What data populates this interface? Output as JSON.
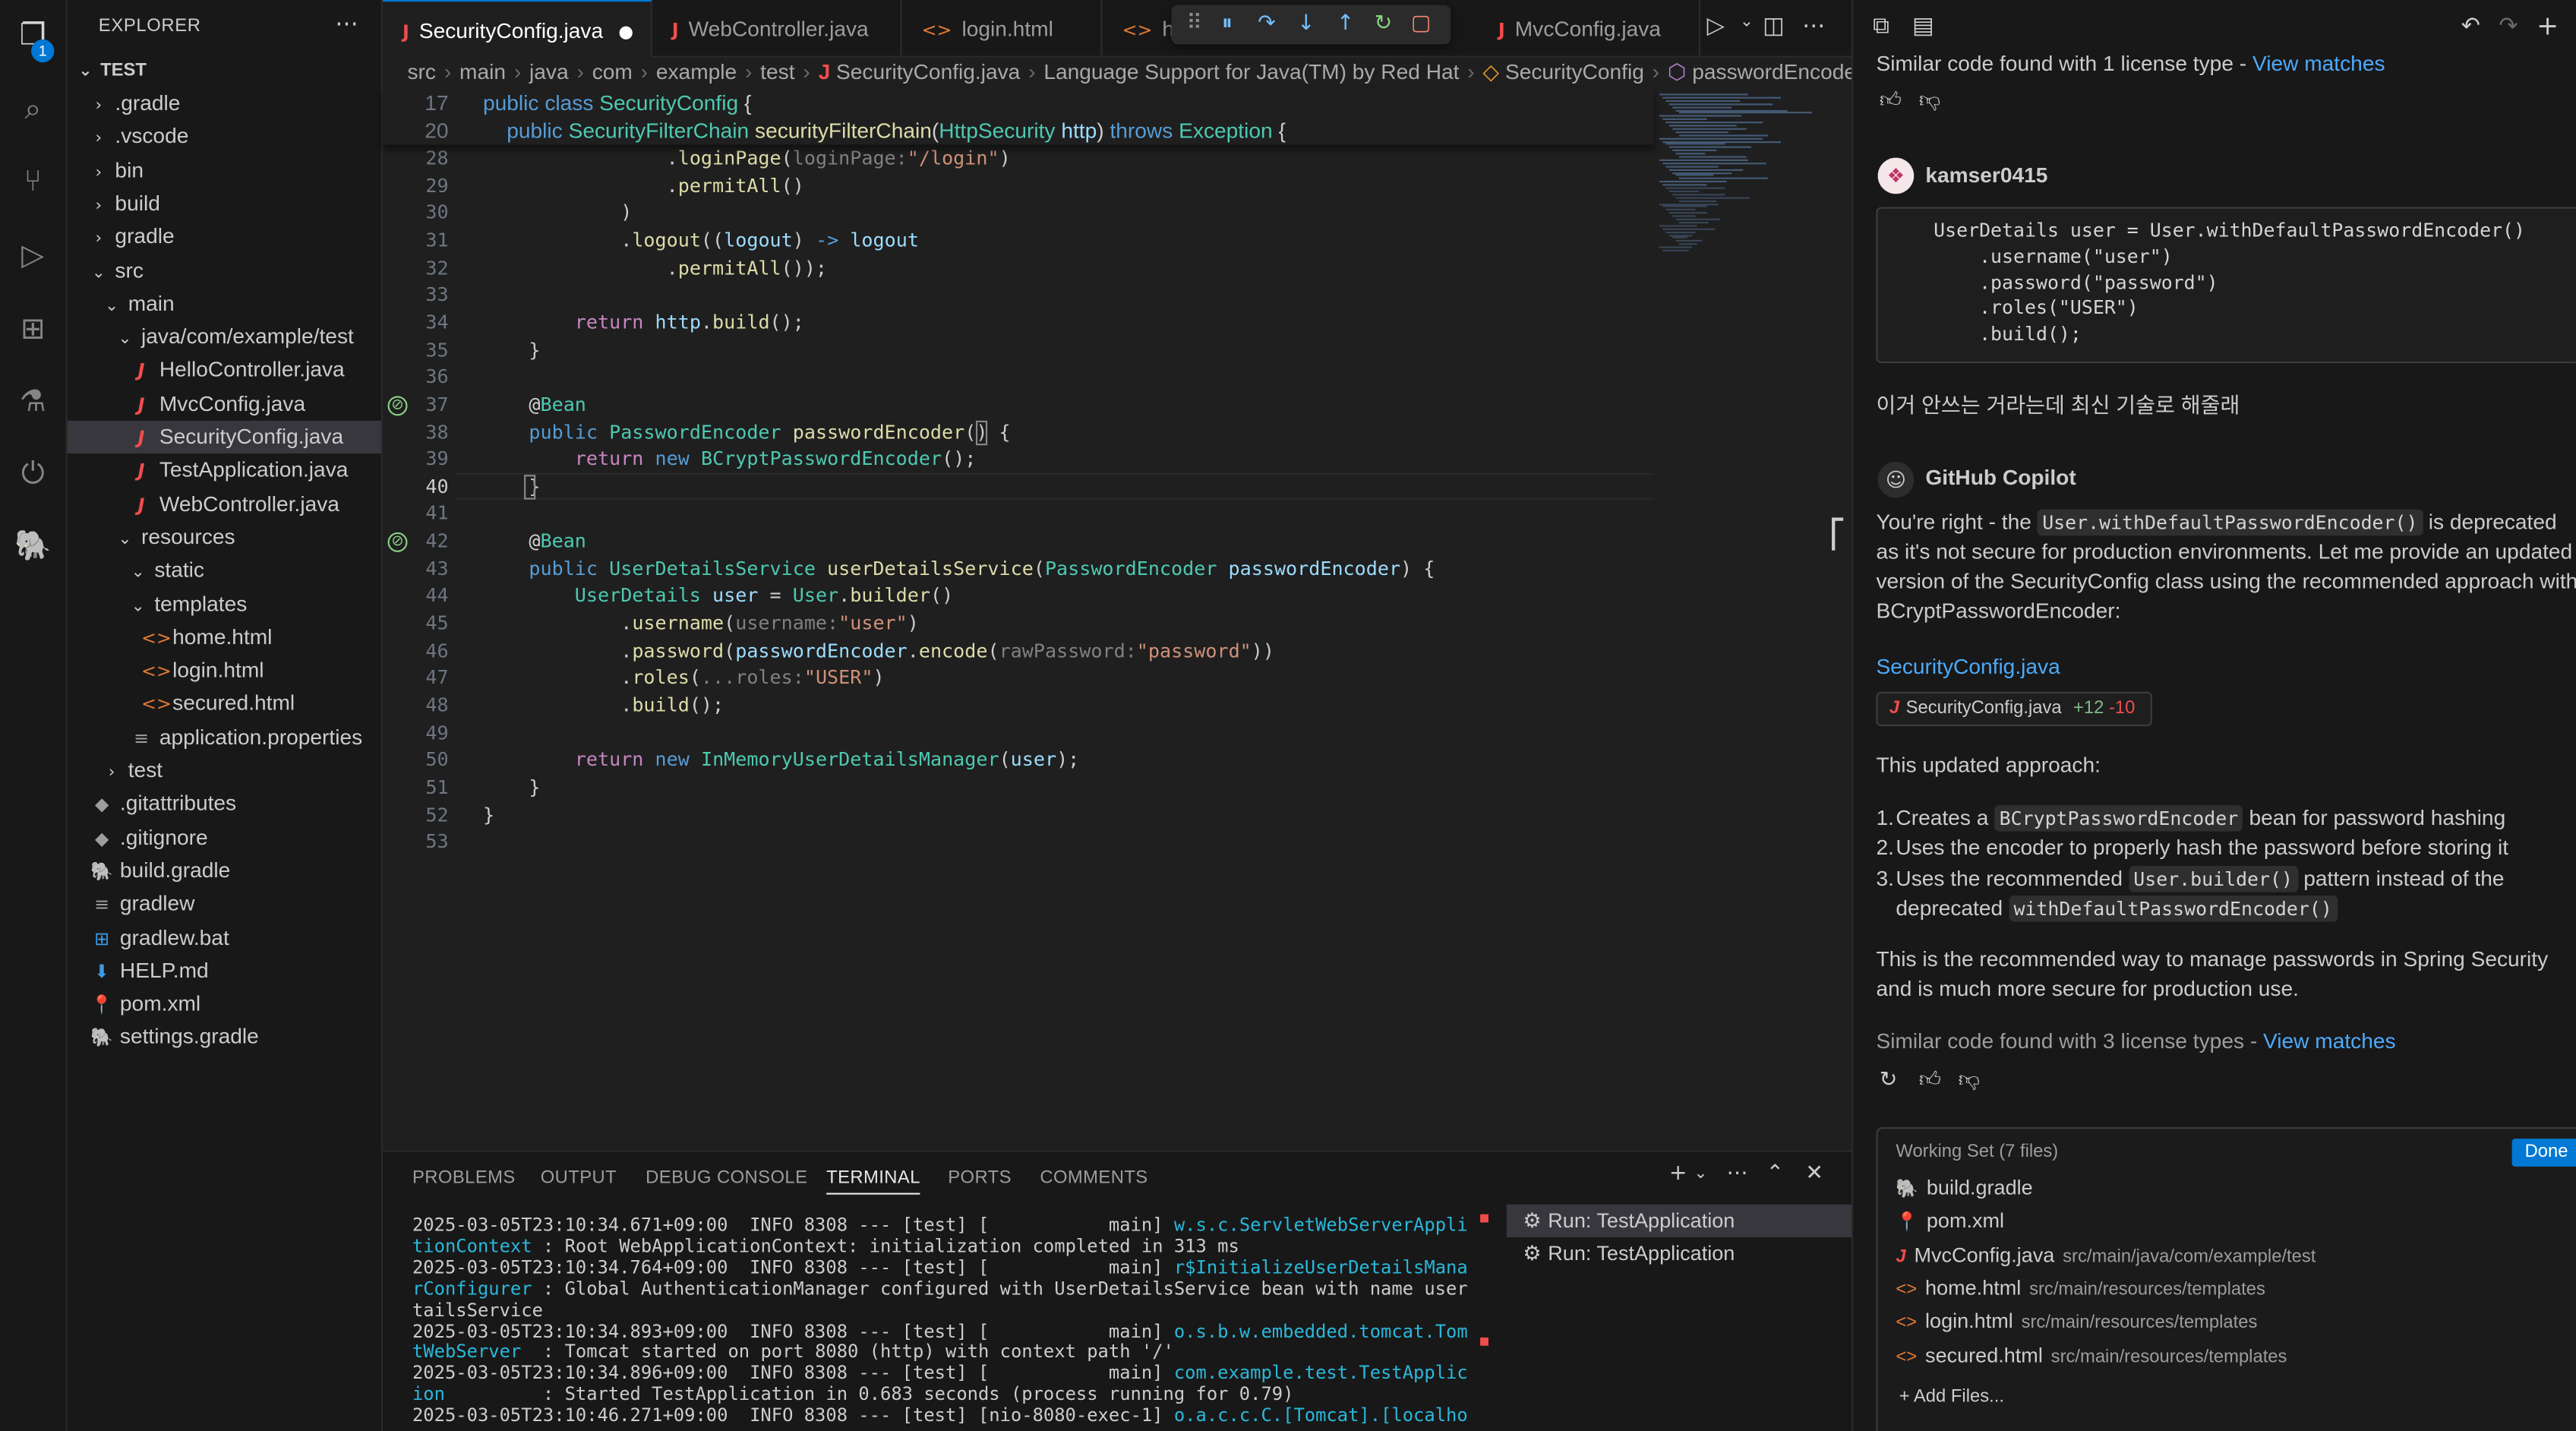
{
  "activity": {
    "badge_count": "1"
  },
  "explorer": {
    "title": "EXPLORER",
    "root": "TEST",
    "items": [
      {
        "label": ".gradle",
        "kind": "folder",
        "depth": 1,
        "open": false
      },
      {
        "label": ".vscode",
        "kind": "folder",
        "depth": 1,
        "open": false
      },
      {
        "label": "bin",
        "kind": "folder",
        "depth": 1,
        "open": false
      },
      {
        "label": "build",
        "kind": "folder",
        "depth": 1,
        "open": false
      },
      {
        "label": "gradle",
        "kind": "folder",
        "depth": 1,
        "open": false
      },
      {
        "label": "src",
        "kind": "folder",
        "depth": 1,
        "open": true
      },
      {
        "label": "main",
        "kind": "folder",
        "depth": 2,
        "open": true
      },
      {
        "label": "java/com/example/test",
        "kind": "folder",
        "depth": 3,
        "open": true
      },
      {
        "label": "HelloController.java",
        "kind": "java",
        "depth": 4
      },
      {
        "label": "MvcConfig.java",
        "kind": "java",
        "depth": 4
      },
      {
        "label": "SecurityConfig.java",
        "kind": "java",
        "depth": 4,
        "selected": true
      },
      {
        "label": "TestApplication.java",
        "kind": "java",
        "depth": 4
      },
      {
        "label": "WebController.java",
        "kind": "java",
        "depth": 4
      },
      {
        "label": "resources",
        "kind": "folder",
        "depth": 3,
        "open": true
      },
      {
        "label": "static",
        "kind": "folder",
        "depth": 4,
        "open": true
      },
      {
        "label": "templates",
        "kind": "folder",
        "depth": 4,
        "open": true
      },
      {
        "label": "home.html",
        "kind": "html",
        "depth": 5
      },
      {
        "label": "login.html",
        "kind": "html",
        "depth": 5
      },
      {
        "label": "secured.html",
        "kind": "html",
        "depth": 5
      },
      {
        "label": "application.properties",
        "kind": "props",
        "depth": 4
      },
      {
        "label": "test",
        "kind": "folder",
        "depth": 2,
        "open": false
      },
      {
        "label": ".gitattributes",
        "kind": "git",
        "depth": 1
      },
      {
        "label": ".gitignore",
        "kind": "git",
        "depth": 1
      },
      {
        "label": "build.gradle",
        "kind": "gradle",
        "depth": 1
      },
      {
        "label": "gradlew",
        "kind": "props",
        "depth": 1
      },
      {
        "label": "gradlew.bat",
        "kind": "bat",
        "depth": 1
      },
      {
        "label": "HELP.md",
        "kind": "md",
        "depth": 1
      },
      {
        "label": "pom.xml",
        "kind": "xml",
        "depth": 1
      },
      {
        "label": "settings.gradle",
        "kind": "gradle",
        "depth": 1
      }
    ]
  },
  "tabs": [
    {
      "label": "SecurityConfig.java",
      "icon": "J",
      "active": true,
      "dirty": true
    },
    {
      "label": "WebController.java",
      "icon": "J"
    },
    {
      "label": "login.html",
      "icon": "<>"
    },
    {
      "label": "hc",
      "icon": "<>"
    },
    {
      "label": "MvcConfig.java",
      "icon": "J"
    }
  ],
  "breadcrumb": [
    "src",
    "main",
    "java",
    "com",
    "example",
    "test",
    "SecurityConfig.java",
    "Language Support for Java(TM) by Red Hat",
    "SecurityConfig",
    "passwordEncoder"
  ],
  "code_lines": [
    {
      "n": "17",
      "html": "<span class='k'>public</span> <span class='k'>class</span> <span class='t'>SecurityConfig</span> {"
    },
    {
      "n": "20",
      "html": "    <span class='k'>public</span> <span class='t'>SecurityFilterChain</span> <span class='f'>securityFilterChain</span>(<span class='t'>HttpSecurity</span> <span class='p'>http</span>) <span class='k'>throws</span> <span class='t'>Exception</span> {"
    },
    {
      "n": "28",
      "html": "                .<span class='f'>loginPage</span>(<span class='h'>loginPage:</span><span class='s'>\"/login\"</span>)"
    },
    {
      "n": "29",
      "html": "                .<span class='f'>permitAll</span>()"
    },
    {
      "n": "30",
      "html": "            )"
    },
    {
      "n": "31",
      "html": "            .<span class='f'>logout</span>((<span class='p'>logout</span>) <span class='k'>-&gt;</span> <span class='p'>logout</span>"
    },
    {
      "n": "32",
      "html": "                .<span class='f'>permitAll</span>());"
    },
    {
      "n": "33",
      "html": ""
    },
    {
      "n": "34",
      "html": "        <span class='k2'>return</span> <span class='p'>http</span>.<span class='f'>build</span>();"
    },
    {
      "n": "35",
      "html": "    }"
    },
    {
      "n": "36",
      "html": ""
    },
    {
      "n": "37",
      "html": "    <span class='an'>@</span><span class='t'>Bean</span>"
    },
    {
      "n": "38",
      "html": "    <span class='k'>public</span> <span class='t'>PasswordEncoder</span> <span class='f'>passwordEncoder</span>() {"
    },
    {
      "n": "39",
      "html": "        <span class='k2'>return</span> <span class='k'>new</span> <span class='t'>BCryptPasswordEncoder</span>();"
    },
    {
      "n": "40",
      "html": "    }"
    },
    {
      "n": "41",
      "html": ""
    },
    {
      "n": "42",
      "html": "    <span class='an'>@</span><span class='t'>Bean</span>"
    },
    {
      "n": "43",
      "html": "    <span class='k'>public</span> <span class='t'>UserDetailsService</span> <span class='f'>userDetailsService</span>(<span class='t'>PasswordEncoder</span> <span class='p'>passwordEncoder</span>) {"
    },
    {
      "n": "44",
      "html": "        <span class='t'>UserDetails</span> <span class='p'>user</span> = <span class='t'>User</span>.<span class='f'>builder</span>()"
    },
    {
      "n": "45",
      "html": "            .<span class='f'>username</span>(<span class='h'>username:</span><span class='s'>\"user\"</span>)"
    },
    {
      "n": "46",
      "html": "            .<span class='f'>password</span>(<span class='p'>passwordEncoder</span>.<span class='f'>encode</span>(<span class='h'>rawPassword:</span><span class='s'>\"password\"</span>))"
    },
    {
      "n": "47",
      "html": "            .<span class='f'>roles</span>(<span class='h'>...roles:</span><span class='s'>\"USER\"</span>)"
    },
    {
      "n": "48",
      "html": "            .<span class='f'>build</span>();"
    },
    {
      "n": "49",
      "html": ""
    },
    {
      "n": "50",
      "html": "        <span class='k2'>return</span> <span class='k'>new</span> <span class='t'>InMemoryUserDetailsManager</span>(<span class='p'>user</span>);"
    },
    {
      "n": "51",
      "html": "    }"
    },
    {
      "n": "52",
      "html": "}"
    },
    {
      "n": "53",
      "html": ""
    }
  ],
  "panel": {
    "tabs": [
      "PROBLEMS",
      "OUTPUT",
      "DEBUG CONSOLE",
      "TERMINAL",
      "PORTS",
      "COMMENTS"
    ],
    "terminal_lines": [
      {
        "a": "2025-03-05T23:10:34.671+09:00  INFO 8308 --- [test] [           main] ",
        "c": "w.s.c.ServletWebServerApplica"
      },
      {
        "a": "tionContext",
        "b": " : Root WebApplicationContext: initialization completed in 313 ms",
        "cyanfirst": true
      },
      {
        "a": "2025-03-05T23:10:34.764+09:00  INFO 8308 --- [test] [           main] ",
        "c": "r$InitializeUserDetailsManage"
      },
      {
        "a": "rConfigurer",
        "b": " : Global AuthenticationManager configured with UserDetailsService bean with name userDe",
        "cyanfirst": true
      },
      {
        "a": "tailsService"
      },
      {
        "a": "2025-03-05T23:10:34.893+09:00  INFO 8308 --- [test] [           main] ",
        "c": "o.s.b.w.embedded.tomcat.Tomca"
      },
      {
        "a": "tWebServer",
        "b": "  : Tomcat started on port 8080 (http) with context path '/'",
        "cyanfirst": true
      },
      {
        "a": "2025-03-05T23:10:34.896+09:00  INFO 8308 --- [test] [           main] ",
        "c": "com.example.test.TestApplicat"
      },
      {
        "a": "ion",
        "b": "         : Started TestApplication in 0.683 seconds (process running for 0.79)",
        "cyanfirst": true
      },
      {
        "a": "2025-03-05T23:10:46.271+09:00  INFO 8308 --- [test] [nio-8080-exec-1] ",
        "c": "o.a.c.c.C.[Tomcat].[localhost"
      }
    ],
    "run_items": [
      "Run: TestApplication",
      "Run: TestApplication"
    ]
  },
  "chat": {
    "license_top": "Similar code found with 1 license type - ",
    "view_matches": "View matches",
    "user_name": "kamser0415",
    "user_code": "UserDetails user = User.withDefaultPasswordEncoder()\n    .username(\"user\")\n    .password(\"password\")\n    .roles(\"USER\")\n    .build();",
    "user_message": "이거 안쓰는 거라는데 최신 기술로 해줄래",
    "copilot_name": "GitHub Copilot",
    "reply_p1_a": "You're right - the ",
    "reply_p1_code": "User.withDefaultPasswordEncoder()",
    "reply_p1_b": " is deprecated as it's not secure for production environments. Let me provide an updated version of the SecurityConfig class using the recommended approach with BCryptPasswordEncoder:",
    "file_link": "SecurityConfig.java",
    "file_chip": "SecurityConfig.java",
    "added": "+12",
    "removed": "-10",
    "approach_intro": "This updated approach:",
    "li1_a": "Creates a ",
    "li1_code": "BCryptPasswordEncoder",
    "li1_b": " bean for password hashing",
    "li2": "Uses the encoder to properly hash the password before storing it",
    "li3_a": "Uses the recommended ",
    "li3_code": "User.builder()",
    "li3_b": " pattern instead of the deprecated ",
    "li3_code2": "withDefaultPasswordEncoder()",
    "closing": "This is the recommended way to manage passwords in Spring Security and is much more secure for production use.",
    "license_bottom": "Similar code found with 3 license types - ",
    "working_set_title": "Working Set (7 files)",
    "done": "Done",
    "working_set": [
      {
        "name": "build.gradle",
        "path": "",
        "kind": "gradle"
      },
      {
        "name": "pom.xml",
        "path": "",
        "kind": "xml"
      },
      {
        "name": "MvcConfig.java",
        "path": "src/main/java/com/example/test",
        "kind": "java"
      },
      {
        "name": "home.html",
        "path": "src/main/resources/templates",
        "kind": "html"
      },
      {
        "name": "login.html",
        "path": "src/main/resources/templates",
        "kind": "html"
      },
      {
        "name": "secured.html",
        "path": "src/main/resources/templates",
        "kind": "html"
      }
    ],
    "add_files": "+ Add Files..."
  }
}
